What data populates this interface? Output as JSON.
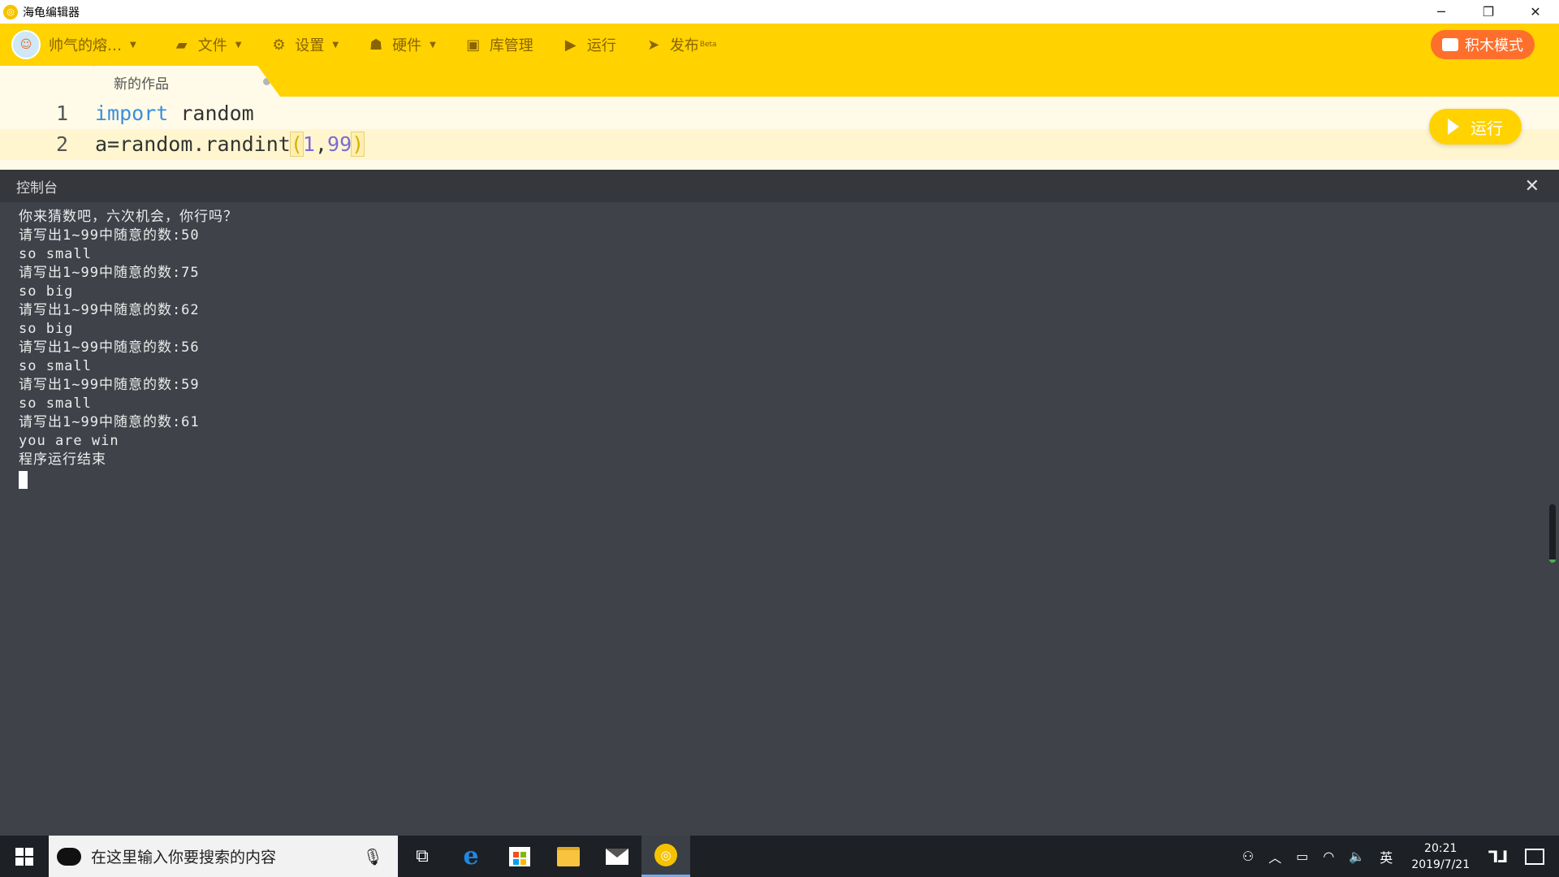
{
  "window": {
    "title": "海龟编辑器",
    "minimize": "─",
    "restore": "❐",
    "close": "✕"
  },
  "toolbar": {
    "user": {
      "avatar_glyph": "☺",
      "name": "帅气的熔…"
    },
    "file": "文件",
    "settings": "设置",
    "hardware": "硬件",
    "library": "库管理",
    "run": "运行",
    "publish": "发布",
    "publish_badge": "Beta",
    "block_mode": "积木模式",
    "icons": {
      "file": "folder-icon",
      "settings": "gear-icon",
      "hardware": "robot-icon",
      "library": "inbox-icon",
      "run": "play-circle-icon",
      "publish": "paper-plane-icon"
    },
    "accent_color": "#ffd200"
  },
  "tab": {
    "label": "新的作品"
  },
  "editor": {
    "lines": [
      {
        "number": "1",
        "code": "import random"
      },
      {
        "number": "2",
        "code": "a=random.randint(1,99)"
      }
    ],
    "run_button": "运行"
  },
  "console": {
    "title": "控制台",
    "close": "✕",
    "output": [
      "你来猜数吧，六次机会，你行吗？",
      "请写出1~99中随意的数:50",
      "so small",
      "请写出1~99中随意的数:75",
      "so big",
      "请写出1~99中随意的数:62",
      "so big",
      "请写出1~99中随意的数:56",
      "so small",
      "请写出1~99中随意的数:59",
      "so small",
      "请写出1~99中随意的数:61",
      "you are win",
      "程序运行结束"
    ]
  },
  "taskbar": {
    "search_placeholder": "在这里输入你要搜索的内容",
    "mic_glyph": "🎙",
    "task_view_glyph": "⧉",
    "ime": "英",
    "time": "20:21",
    "date": "2019/7/21",
    "tray_glyphs": {
      "people": "⚇",
      "chevron": "︿",
      "battery": "▭",
      "wifi": "◠",
      "volume": "🔈"
    }
  }
}
